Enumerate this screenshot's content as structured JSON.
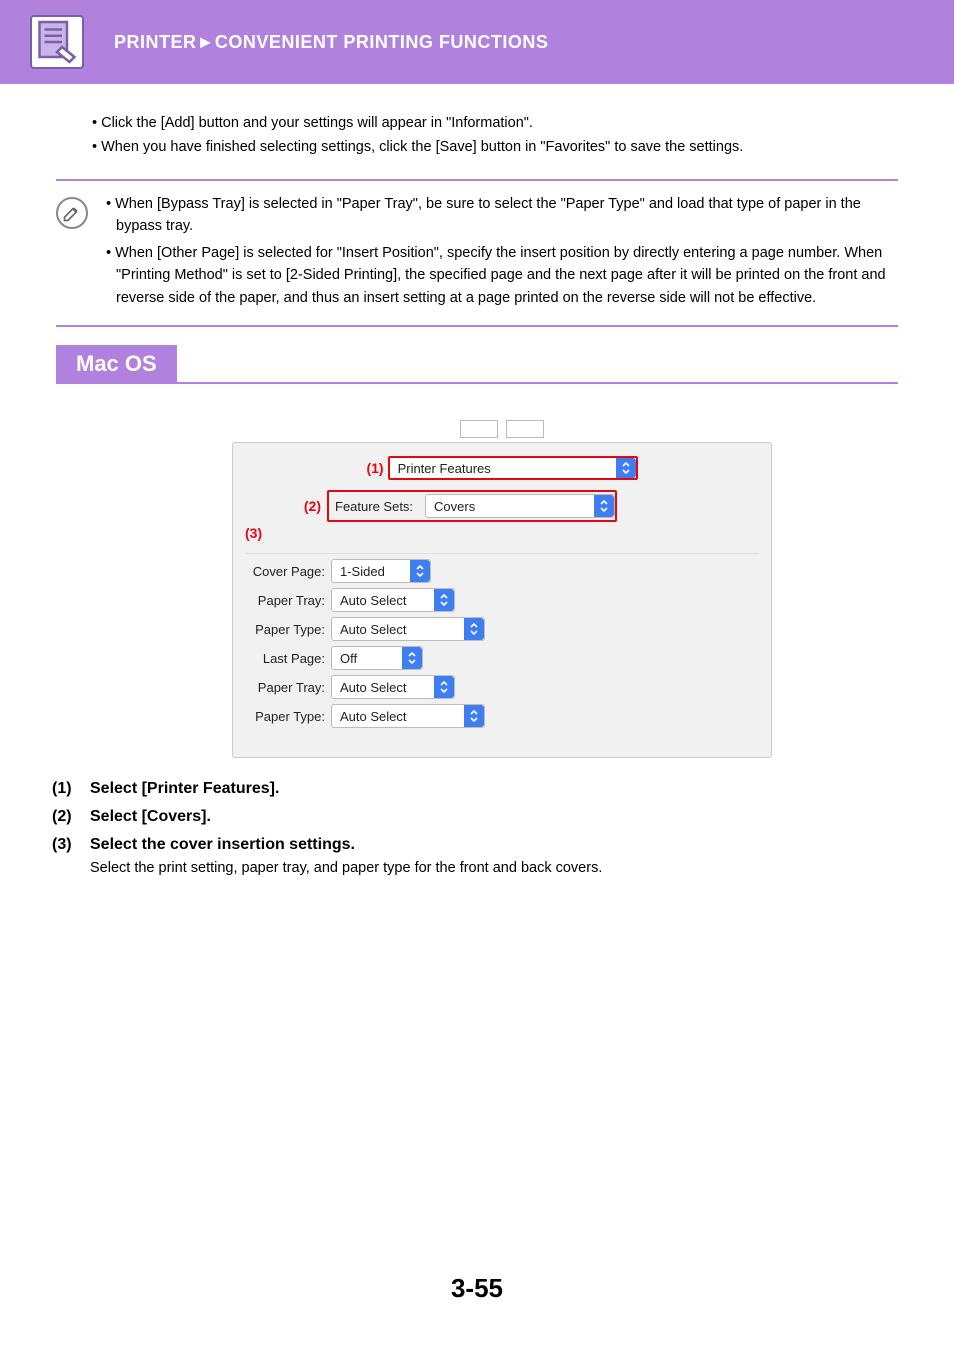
{
  "breadcrumb": {
    "part1": "PRINTER",
    "sep": "►",
    "part2": "CONVENIENT PRINTING FUNCTIONS"
  },
  "top_bullets": {
    "b1": "• Click the [Add] button and your settings will appear in \"Information\".",
    "b2": "• When you have finished selecting settings, click the [Save] button in \"Favorites\" to save the settings."
  },
  "note": {
    "n1": "• When [Bypass Tray] is selected in \"Paper Tray\", be sure to select the \"Paper Type\" and load that type of paper in the bypass tray.",
    "n2": "• When [Other Page] is selected for \"Insert Position\", specify the insert position by directly entering a page number. When \"Printing Method\" is set to [2-Sided Printing], the specified page and the next page after it will be printed on the front and reverse side of the paper, and thus an insert setting at a page printed on the reverse side will not be effective."
  },
  "os_label": "Mac OS",
  "callouts": {
    "c1": "(1)",
    "c2": "(2)",
    "c3": "(3)"
  },
  "dialog": {
    "top_select": "Printer Features",
    "feature_sets_label": "Feature Sets:",
    "feature_sets_value": "Covers",
    "rows": {
      "cover_page": {
        "label": "Cover Page:",
        "value": "1-Sided"
      },
      "paper_tray1": {
        "label": "Paper Tray:",
        "value": "Auto Select"
      },
      "paper_type1": {
        "label": "Paper Type:",
        "value": "Auto Select"
      },
      "last_page": {
        "label": "Last Page:",
        "value": "Off"
      },
      "paper_tray2": {
        "label": "Paper Tray:",
        "value": "Auto Select"
      },
      "paper_type2": {
        "label": "Paper Type:",
        "value": "Auto Select"
      }
    }
  },
  "steps": {
    "s1": {
      "num": "(1)",
      "title": "Select [Printer Features]."
    },
    "s2": {
      "num": "(2)",
      "title": "Select [Covers]."
    },
    "s3": {
      "num": "(3)",
      "title": "Select the cover insertion settings.",
      "desc": "Select the print setting, paper tray, and paper type for the front and back covers."
    }
  },
  "page_number": "3-55"
}
